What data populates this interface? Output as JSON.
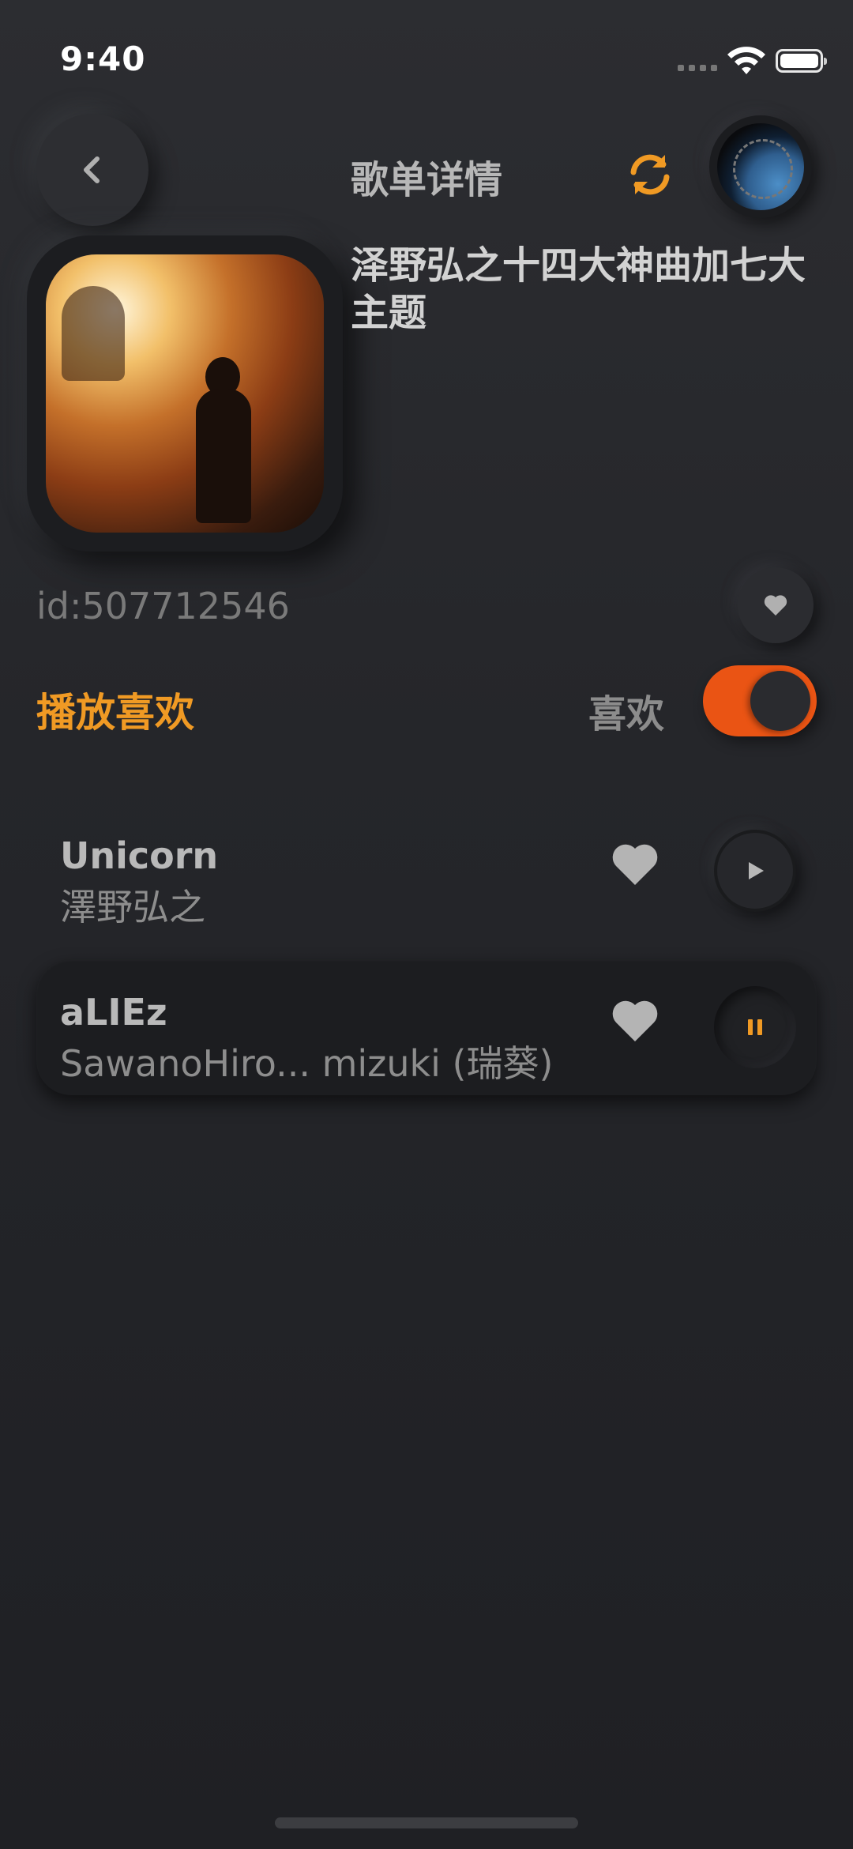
{
  "status_bar": {
    "time": "9:40"
  },
  "header": {
    "title": "歌单详情",
    "back_icon": "chevron-left-icon",
    "refresh_icon": "refresh-icon",
    "accent_color": "#f09a24"
  },
  "playlist": {
    "title": "泽野弘之十四大神曲加七大主题",
    "id_text": "id:507712546"
  },
  "controls": {
    "play_liked_label": "播放喜欢",
    "like_label": "喜欢",
    "like_toggle_on": true,
    "toggle_color": "#ea5414"
  },
  "songs": [
    {
      "title": "Unicorn",
      "artist": "澤野弘之",
      "playing": false
    },
    {
      "title": "aLIEz",
      "artist": "SawanoHiro...  mizuki (瑞葵)",
      "playing": true
    }
  ]
}
